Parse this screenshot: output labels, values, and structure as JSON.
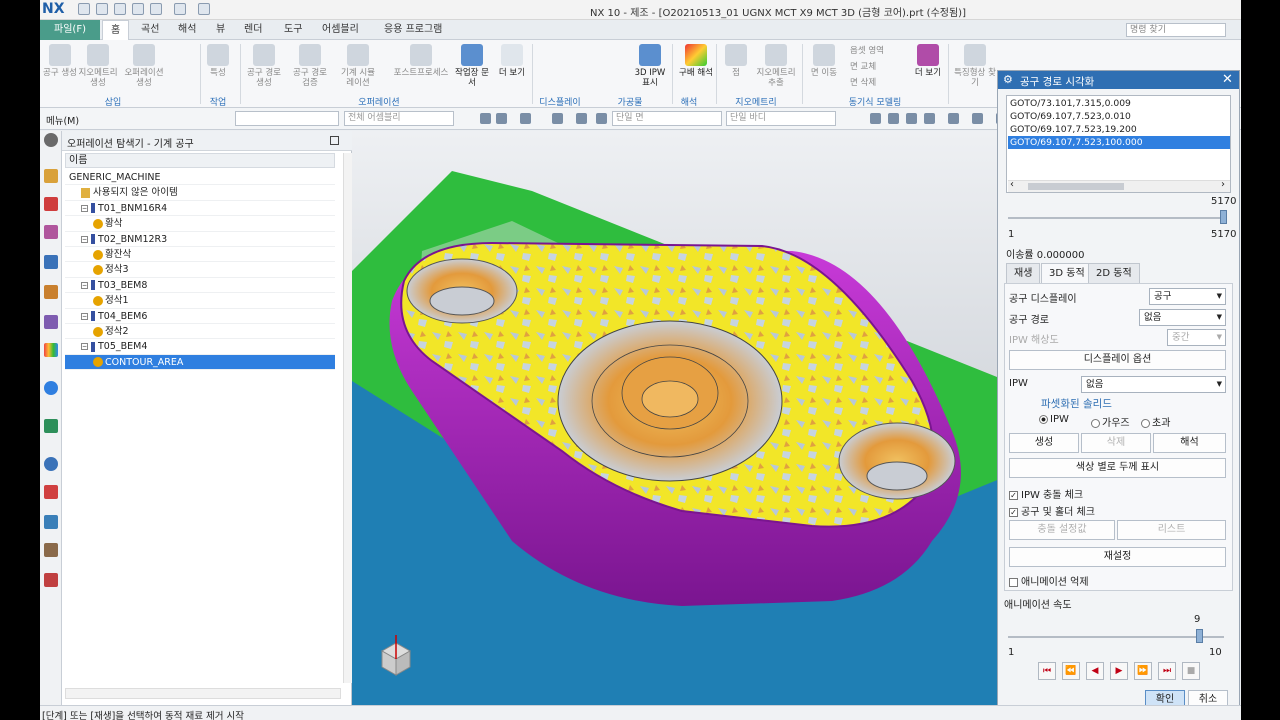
{
  "titlebar": {
    "logo": "NX",
    "title": "NX 10 - 제조 - [O20210513_01 UGNX MCT X9 MCT 3D (금형 코어).prt (수정됨)]"
  },
  "menu": {
    "file": "파일(F)",
    "tabs": [
      "홈",
      "곡선",
      "해석",
      "뷰",
      "렌더",
      "도구",
      "어셈블리",
      "응용 프로그램"
    ],
    "search_placeholder": "명령 찾기"
  },
  "ribbon": {
    "buttons": [
      {
        "label": "공구 생성"
      },
      {
        "label": "지오메트리 생성"
      },
      {
        "label": "오퍼레이션 생성"
      },
      {
        "label": "특성"
      },
      {
        "label": "공구 경로 생성"
      },
      {
        "label": "공구 경로 검증"
      },
      {
        "label": "기계 시뮬레이션"
      },
      {
        "label": "포스트프로세스"
      },
      {
        "label": "작업장 문서"
      },
      {
        "label": "더 보기"
      },
      {
        "label": "3D IPW 표시"
      },
      {
        "label": "구배 해석"
      },
      {
        "label": "점"
      },
      {
        "label": "지오메트리 추출"
      },
      {
        "label": "면 이동"
      },
      {
        "label": "옵셋 영역"
      },
      {
        "label": "면 교체"
      },
      {
        "label": "면 삭제"
      },
      {
        "label": "더 보기"
      },
      {
        "label": "특징형상 찾기"
      }
    ],
    "groups": [
      "삽입",
      "작업",
      "오퍼레이션",
      "디스플레이",
      "가공물",
      "해석",
      "지오메트리",
      "동기식 모델링"
    ]
  },
  "toolbar2": {
    "menu_label": "메뉴(M)",
    "combo1": "",
    "combo2": "전체 어셈블리",
    "combo3": "단일 면",
    "combo4": "단일 바디"
  },
  "navigator": {
    "title": "오퍼레이션 탐색기 - 기계 공구",
    "column": "이름",
    "rows": [
      {
        "text": "GENERIC_MACHINE",
        "indent": 0,
        "kind": "root"
      },
      {
        "text": "사용되지 않은 아이템",
        "indent": 1,
        "kind": "folder"
      },
      {
        "text": "T01_BNM16R4",
        "indent": 1,
        "kind": "tool"
      },
      {
        "text": "황삭",
        "indent": 2,
        "kind": "op"
      },
      {
        "text": "T02_BNM12R3",
        "indent": 1,
        "kind": "tool"
      },
      {
        "text": "황잔삭",
        "indent": 2,
        "kind": "op"
      },
      {
        "text": "정삭3",
        "indent": 2,
        "kind": "op"
      },
      {
        "text": "T03_BEM8",
        "indent": 1,
        "kind": "tool"
      },
      {
        "text": "정삭1",
        "indent": 2,
        "kind": "op"
      },
      {
        "text": "T04_BEM6",
        "indent": 1,
        "kind": "tool"
      },
      {
        "text": "정삭2",
        "indent": 2,
        "kind": "op"
      },
      {
        "text": "T05_BEM4",
        "indent": 1,
        "kind": "tool"
      },
      {
        "text": "CONTOUR_AREA",
        "indent": 2,
        "kind": "op",
        "selected": true
      }
    ]
  },
  "dialog": {
    "title": "공구 경로 시각화",
    "path_list": [
      "GOTO/73.101,7.315,0.009",
      "GOTO/69.107,7.523,0.010",
      "GOTO/69.107,7.523,19.200",
      "GOTO/69.107,7.523,100.000"
    ],
    "selected_index": 3,
    "slider_max": "5170",
    "slider_min": "1",
    "slider_max_label": "5170",
    "slider_value": 1.0,
    "feed_label": "이송률 0.000000",
    "tabs": [
      "재생",
      "3D 동적",
      "2D 동적"
    ],
    "active_tab": 1,
    "tool_display_label": "공구 디스플레이",
    "tool_display_value": "공구",
    "tool_path_label": "공구 경로",
    "tool_path_value": "없음",
    "ipw_res_label": "IPW 해상도",
    "ipw_res_value": "중간",
    "display_options": "디스플레이 옵션",
    "ipw_label": "IPW",
    "ipw_value": "없음",
    "faceted_solid": "파셋화된 솔리드",
    "radio_ipw": "IPW",
    "radio_gouge": "가우즈",
    "radio_excess": "초과",
    "btn_create": "생성",
    "btn_delete": "삭제",
    "btn_analyze": "해석",
    "btn_color_thickness": "색상 별로 두께 표시",
    "chk_ipw_collision": "IPW 충돌 체크",
    "chk_tool_holder": "공구 및 홀더 체크",
    "btn_collision_settings": "충돌 설정값",
    "btn_list": "리스트",
    "btn_reset": "재설정",
    "chk_suppress_anim": "애니메이션 억제",
    "anim_speed_label": "애니메이션 속도",
    "anim_value": "9",
    "anim_min": "1",
    "anim_max": "10",
    "anim_level": 0.889,
    "playback": [
      "⏮",
      "⏪",
      "◀",
      "▶",
      "⏩",
      "⏭",
      "■"
    ],
    "ok": "확인",
    "cancel": "취소"
  },
  "status": {
    "text": "[단계] 또는 [재생]을 선택하여 동적 재료 제거 시작"
  },
  "colors": {
    "accent": "#2f6fb3",
    "file_tab": "#4a9c8a",
    "selection": "#2f7fe0",
    "part_top": "#f2e628",
    "part_wall": "#a321b8",
    "stock_green": "#2fbd3e",
    "stock_blue": "#1f7fb4",
    "pocket_orange": "#e6a043"
  }
}
